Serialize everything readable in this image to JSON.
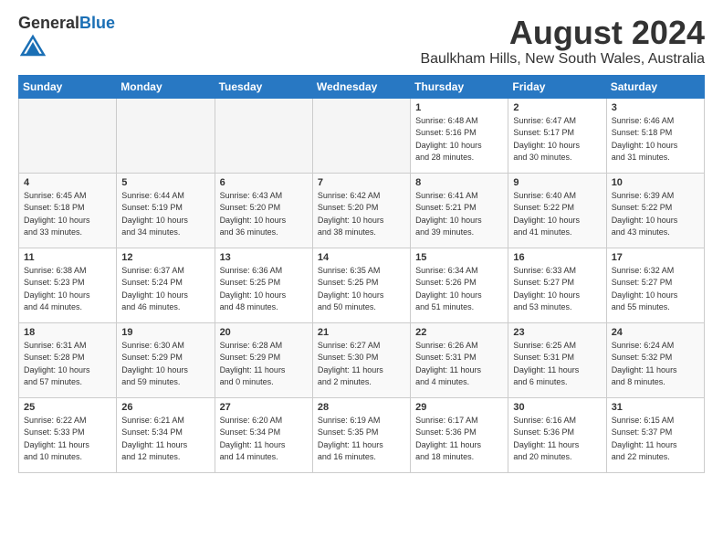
{
  "header": {
    "logo_general": "General",
    "logo_blue": "Blue",
    "title": "August 2024",
    "location": "Baulkham Hills, New South Wales, Australia"
  },
  "days_of_week": [
    "Sunday",
    "Monday",
    "Tuesday",
    "Wednesday",
    "Thursday",
    "Friday",
    "Saturday"
  ],
  "weeks": [
    [
      {
        "day": "",
        "info": ""
      },
      {
        "day": "",
        "info": ""
      },
      {
        "day": "",
        "info": ""
      },
      {
        "day": "",
        "info": ""
      },
      {
        "day": "1",
        "info": "Sunrise: 6:48 AM\nSunset: 5:16 PM\nDaylight: 10 hours\nand 28 minutes."
      },
      {
        "day": "2",
        "info": "Sunrise: 6:47 AM\nSunset: 5:17 PM\nDaylight: 10 hours\nand 30 minutes."
      },
      {
        "day": "3",
        "info": "Sunrise: 6:46 AM\nSunset: 5:18 PM\nDaylight: 10 hours\nand 31 minutes."
      }
    ],
    [
      {
        "day": "4",
        "info": "Sunrise: 6:45 AM\nSunset: 5:18 PM\nDaylight: 10 hours\nand 33 minutes."
      },
      {
        "day": "5",
        "info": "Sunrise: 6:44 AM\nSunset: 5:19 PM\nDaylight: 10 hours\nand 34 minutes."
      },
      {
        "day": "6",
        "info": "Sunrise: 6:43 AM\nSunset: 5:20 PM\nDaylight: 10 hours\nand 36 minutes."
      },
      {
        "day": "7",
        "info": "Sunrise: 6:42 AM\nSunset: 5:20 PM\nDaylight: 10 hours\nand 38 minutes."
      },
      {
        "day": "8",
        "info": "Sunrise: 6:41 AM\nSunset: 5:21 PM\nDaylight: 10 hours\nand 39 minutes."
      },
      {
        "day": "9",
        "info": "Sunrise: 6:40 AM\nSunset: 5:22 PM\nDaylight: 10 hours\nand 41 minutes."
      },
      {
        "day": "10",
        "info": "Sunrise: 6:39 AM\nSunset: 5:22 PM\nDaylight: 10 hours\nand 43 minutes."
      }
    ],
    [
      {
        "day": "11",
        "info": "Sunrise: 6:38 AM\nSunset: 5:23 PM\nDaylight: 10 hours\nand 44 minutes."
      },
      {
        "day": "12",
        "info": "Sunrise: 6:37 AM\nSunset: 5:24 PM\nDaylight: 10 hours\nand 46 minutes."
      },
      {
        "day": "13",
        "info": "Sunrise: 6:36 AM\nSunset: 5:25 PM\nDaylight: 10 hours\nand 48 minutes."
      },
      {
        "day": "14",
        "info": "Sunrise: 6:35 AM\nSunset: 5:25 PM\nDaylight: 10 hours\nand 50 minutes."
      },
      {
        "day": "15",
        "info": "Sunrise: 6:34 AM\nSunset: 5:26 PM\nDaylight: 10 hours\nand 51 minutes."
      },
      {
        "day": "16",
        "info": "Sunrise: 6:33 AM\nSunset: 5:27 PM\nDaylight: 10 hours\nand 53 minutes."
      },
      {
        "day": "17",
        "info": "Sunrise: 6:32 AM\nSunset: 5:27 PM\nDaylight: 10 hours\nand 55 minutes."
      }
    ],
    [
      {
        "day": "18",
        "info": "Sunrise: 6:31 AM\nSunset: 5:28 PM\nDaylight: 10 hours\nand 57 minutes."
      },
      {
        "day": "19",
        "info": "Sunrise: 6:30 AM\nSunset: 5:29 PM\nDaylight: 10 hours\nand 59 minutes."
      },
      {
        "day": "20",
        "info": "Sunrise: 6:28 AM\nSunset: 5:29 PM\nDaylight: 11 hours\nand 0 minutes."
      },
      {
        "day": "21",
        "info": "Sunrise: 6:27 AM\nSunset: 5:30 PM\nDaylight: 11 hours\nand 2 minutes."
      },
      {
        "day": "22",
        "info": "Sunrise: 6:26 AM\nSunset: 5:31 PM\nDaylight: 11 hours\nand 4 minutes."
      },
      {
        "day": "23",
        "info": "Sunrise: 6:25 AM\nSunset: 5:31 PM\nDaylight: 11 hours\nand 6 minutes."
      },
      {
        "day": "24",
        "info": "Sunrise: 6:24 AM\nSunset: 5:32 PM\nDaylight: 11 hours\nand 8 minutes."
      }
    ],
    [
      {
        "day": "25",
        "info": "Sunrise: 6:22 AM\nSunset: 5:33 PM\nDaylight: 11 hours\nand 10 minutes."
      },
      {
        "day": "26",
        "info": "Sunrise: 6:21 AM\nSunset: 5:34 PM\nDaylight: 11 hours\nand 12 minutes."
      },
      {
        "day": "27",
        "info": "Sunrise: 6:20 AM\nSunset: 5:34 PM\nDaylight: 11 hours\nand 14 minutes."
      },
      {
        "day": "28",
        "info": "Sunrise: 6:19 AM\nSunset: 5:35 PM\nDaylight: 11 hours\nand 16 minutes."
      },
      {
        "day": "29",
        "info": "Sunrise: 6:17 AM\nSunset: 5:36 PM\nDaylight: 11 hours\nand 18 minutes."
      },
      {
        "day": "30",
        "info": "Sunrise: 6:16 AM\nSunset: 5:36 PM\nDaylight: 11 hours\nand 20 minutes."
      },
      {
        "day": "31",
        "info": "Sunrise: 6:15 AM\nSunset: 5:37 PM\nDaylight: 11 hours\nand 22 minutes."
      }
    ]
  ]
}
